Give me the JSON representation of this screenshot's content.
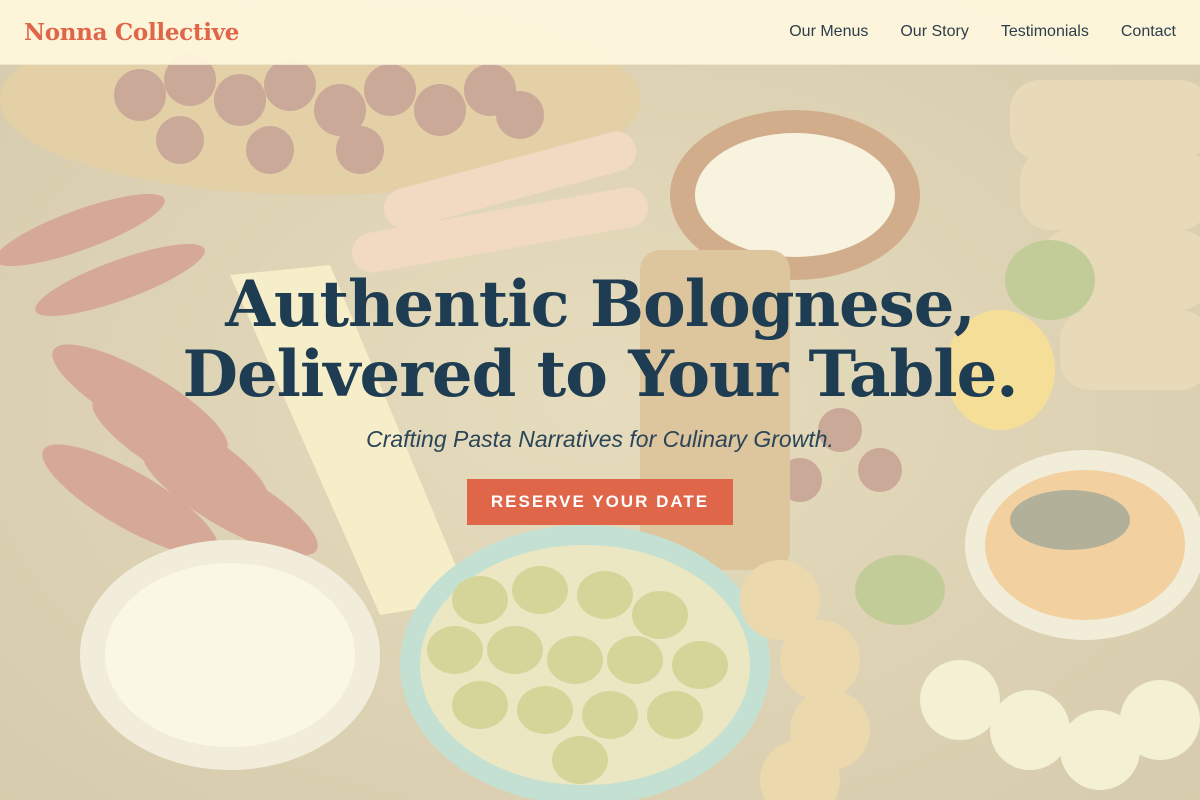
{
  "header": {
    "brand": "Nonna Collective",
    "nav": [
      {
        "label": "Our Menus"
      },
      {
        "label": "Our Story"
      },
      {
        "label": "Testimonials"
      },
      {
        "label": "Contact"
      }
    ]
  },
  "hero": {
    "headline_line1": "Authentic Bolognese,",
    "headline_line2": "Delivered to Your Table.",
    "tagline": "Crafting Pasta Narratives for Culinary Growth.",
    "cta_label": "RESERVE YOUR DATE",
    "background_image": "charcuterie-board-photo"
  },
  "colors": {
    "brand": "#e0664a",
    "headline": "#1e3d52",
    "cta_background": "#e0664a",
    "header_background": "#fff8de"
  }
}
